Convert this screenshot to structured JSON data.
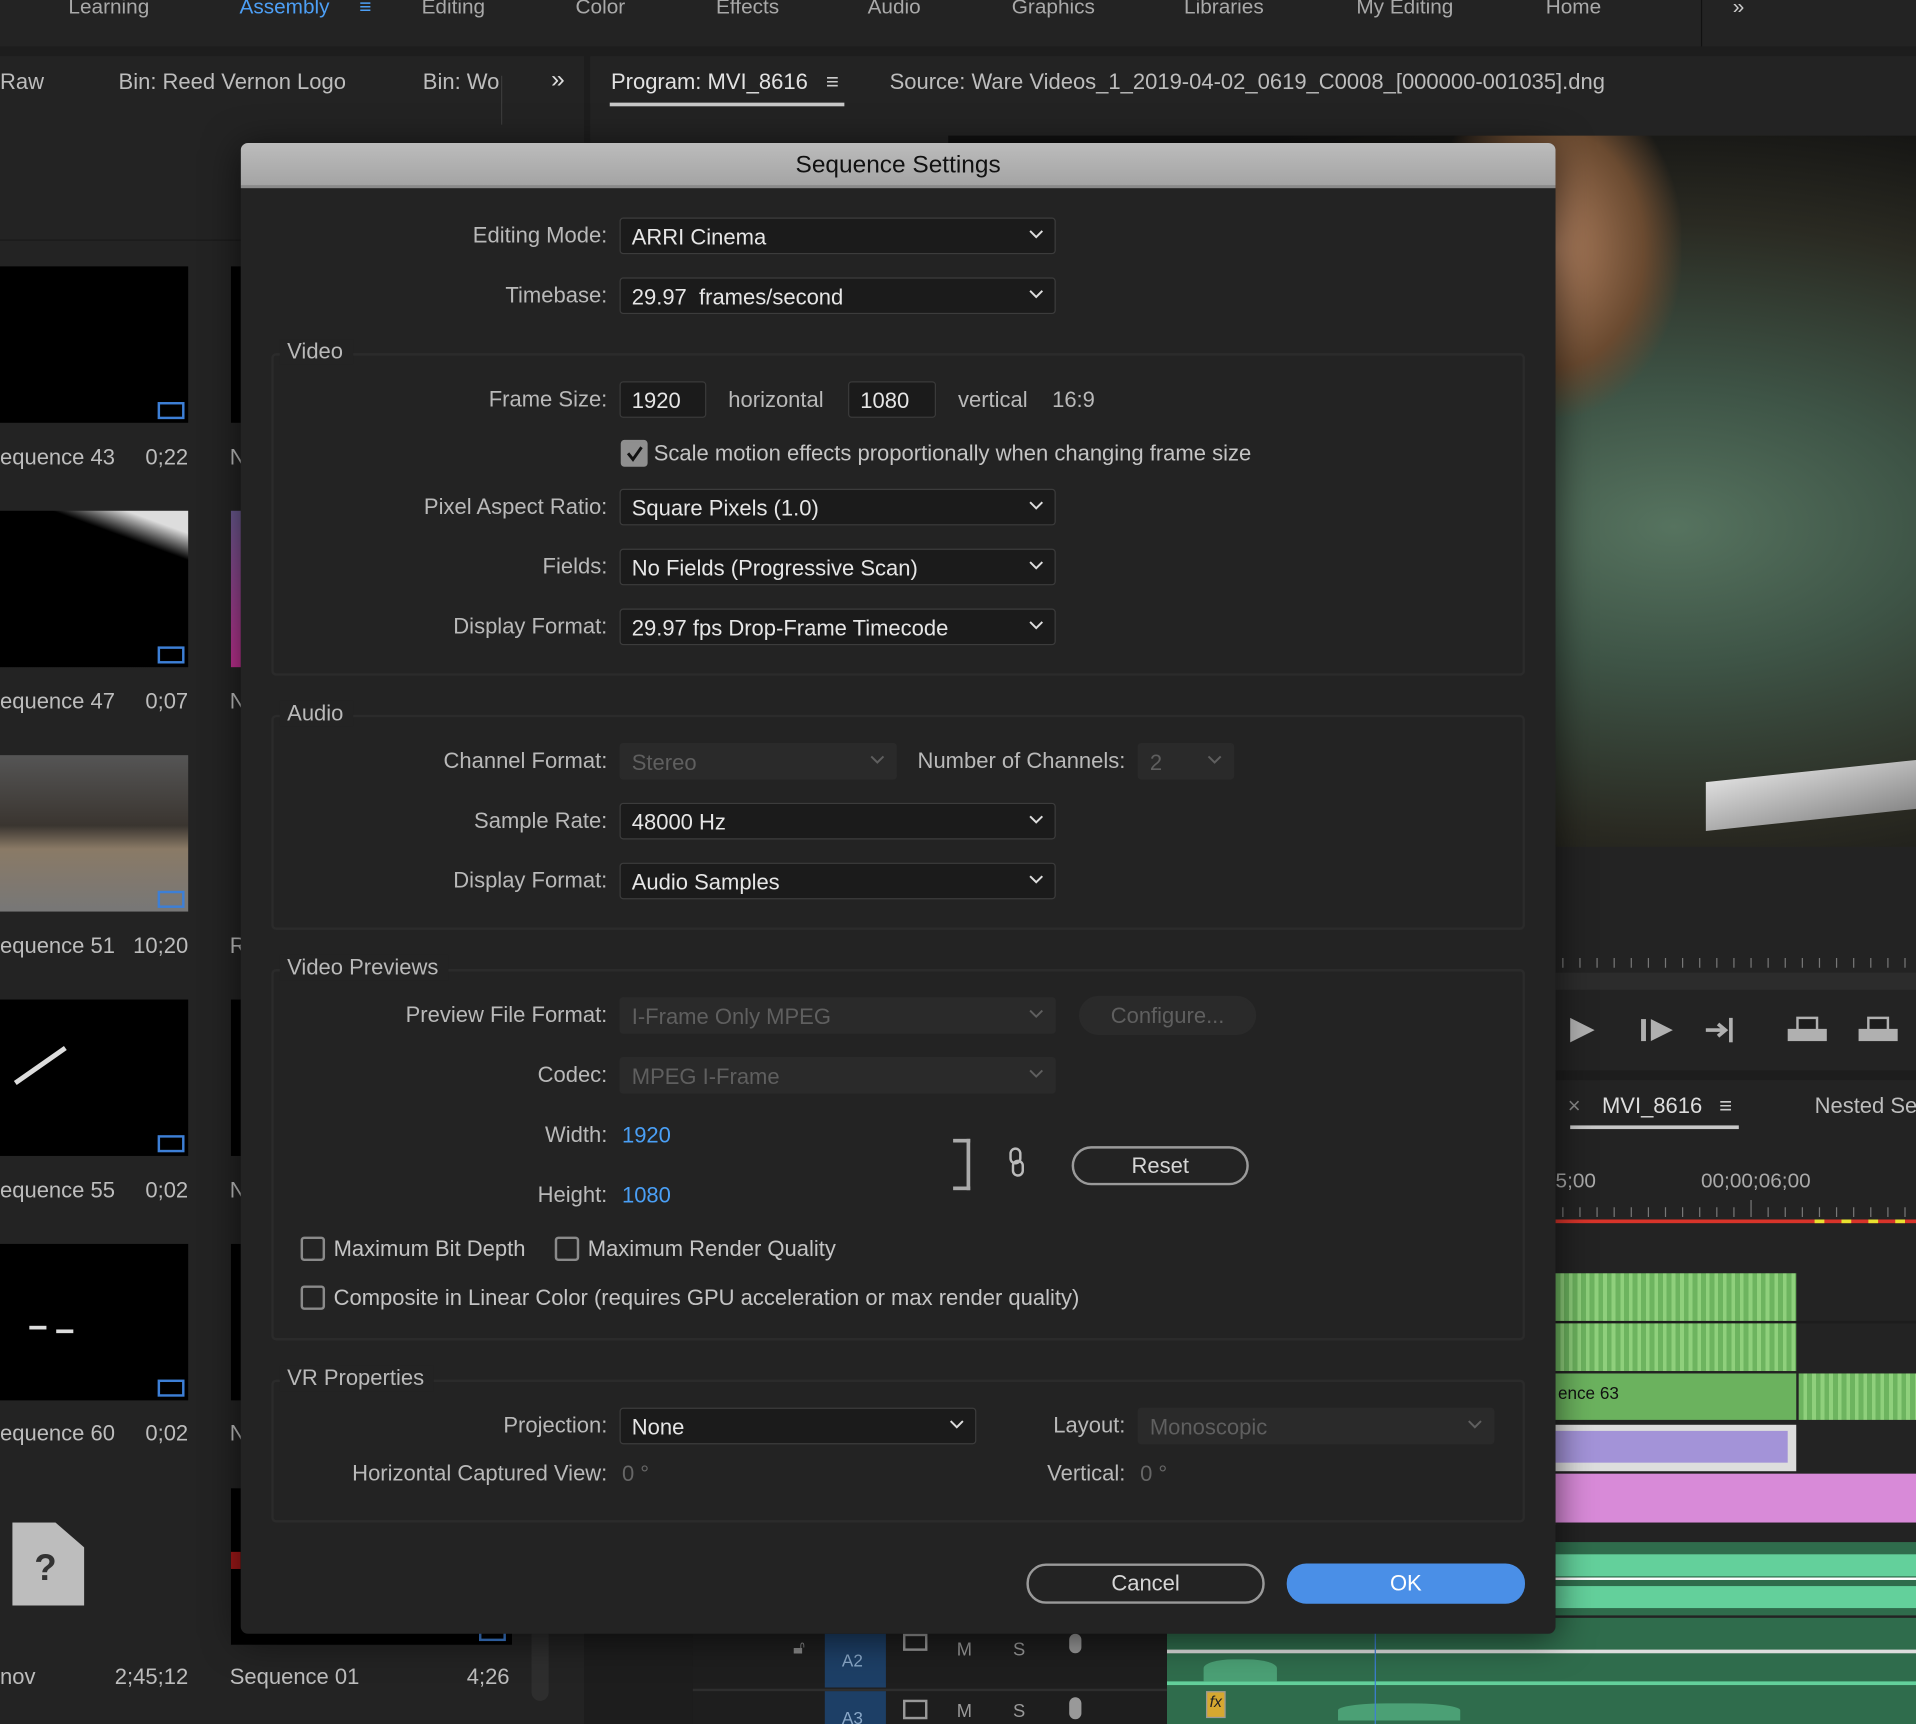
{
  "workspaces": {
    "tabs": [
      "Learning",
      "Assembly",
      "Editing",
      "Color",
      "Effects",
      "Audio",
      "Graphics",
      "Libraries",
      "My Editing",
      "Home"
    ],
    "active": "Assembly",
    "accent": "#4d9ff5"
  },
  "panel_tabs": {
    "left": [
      "Raw",
      "Bin: Reed Vernon Logo",
      "Bin: Wo"
    ],
    "program": "Program: MVI_8616",
    "source": "Source: Ware Videos_1_2019-04-02_0619_C0008_[000000-001035].dng"
  },
  "bin_items": [
    {
      "name": "equence 43",
      "duration": "0;22"
    },
    {
      "name": "equence 47",
      "duration": "0;07"
    },
    {
      "name": "equence 51",
      "duration": "10;20"
    },
    {
      "name": "equence 55",
      "duration": "0;02"
    },
    {
      "name": "equence 60",
      "duration": "0;02"
    },
    {
      "name": "nov",
      "duration": "2;45;12"
    }
  ],
  "bin_col2": [
    "N",
    "N",
    "R",
    "N",
    "N"
  ],
  "bin_col2_last": {
    "name": "Sequence 01",
    "duration": "4;26"
  },
  "timeline": {
    "tab": "MVI_8616",
    "other_tab": "Nested Se",
    "ruler": [
      "5;00",
      "00;00;06;00"
    ],
    "clip_label": "ence 63",
    "tracks": [
      {
        "name": "A2",
        "m": "M",
        "s": "S"
      },
      {
        "name": "A3",
        "m": "M",
        "s": "S"
      }
    ],
    "fx_label": "fx"
  },
  "dialog": {
    "title": "Sequence Settings",
    "editing_mode": {
      "label": "Editing Mode:",
      "value": "ARRI Cinema"
    },
    "timebase": {
      "label": "Timebase:",
      "value": "29.97  frames/second"
    },
    "video": {
      "legend": "Video",
      "frame_size_label": "Frame Size:",
      "width": "1920",
      "horizontal": "horizontal",
      "height": "1080",
      "vertical": "vertical",
      "aspect": "16:9",
      "scale_motion": {
        "label": "Scale motion effects proportionally when changing frame size",
        "checked": true
      },
      "par": {
        "label": "Pixel Aspect Ratio:",
        "value": "Square Pixels (1.0)"
      },
      "fields": {
        "label": "Fields:",
        "value": "No Fields (Progressive Scan)"
      },
      "display_format": {
        "label": "Display Format:",
        "value": "29.97 fps Drop-Frame Timecode"
      }
    },
    "audio": {
      "legend": "Audio",
      "channel_format": {
        "label": "Channel Format:",
        "value": "Stereo",
        "disabled": true
      },
      "num_channels": {
        "label": "Number of Channels:",
        "value": "2",
        "disabled": true
      },
      "sample_rate": {
        "label": "Sample Rate:",
        "value": "48000 Hz"
      },
      "display_format": {
        "label": "Display Format:",
        "value": "Audio Samples"
      }
    },
    "previews": {
      "legend": "Video Previews",
      "file_format": {
        "label": "Preview File Format:",
        "value": "I-Frame Only MPEG",
        "disabled": true
      },
      "configure": "Configure...",
      "codec": {
        "label": "Codec:",
        "value": "MPEG I-Frame",
        "disabled": true
      },
      "width": {
        "label": "Width:",
        "value": "1920"
      },
      "height": {
        "label": "Height:",
        "value": "1080"
      },
      "reset": "Reset",
      "max_bit_depth": {
        "label": "Maximum Bit Depth",
        "checked": false
      },
      "max_render_quality": {
        "label": "Maximum Render Quality",
        "checked": false
      },
      "linear_color": {
        "label": "Composite in Linear Color (requires GPU acceleration or max render quality)",
        "checked": false
      },
      "value_color": "#4a9ff5"
    },
    "vr": {
      "legend": "VR Properties",
      "projection": {
        "label": "Projection:",
        "value": "None"
      },
      "layout": {
        "label": "Layout:",
        "value": "Monoscopic",
        "disabled": true
      },
      "h_view": {
        "label": "Horizontal Captured View:",
        "value": "0 °"
      },
      "vertical": {
        "label": "Vertical:",
        "value": "0 °"
      }
    },
    "cancel": "Cancel",
    "ok": "OK",
    "ok_color": "#4a8fe7"
  }
}
